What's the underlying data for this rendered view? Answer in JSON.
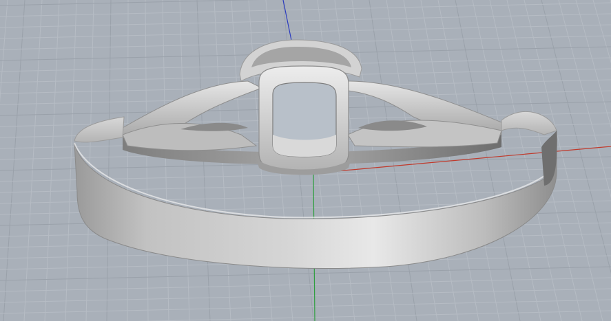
{
  "viewport": {
    "background_color": "#a9b0b9",
    "grid_minor_color": "#b6bcc4",
    "grid_major_color": "#9aa1aa",
    "axis_x_color": "#c0392b",
    "axis_y_color": "#2e9e3e",
    "axis_z_color": "#2b3bbf"
  },
  "model": {
    "name": "",
    "material_color": "#c9c9c9"
  }
}
